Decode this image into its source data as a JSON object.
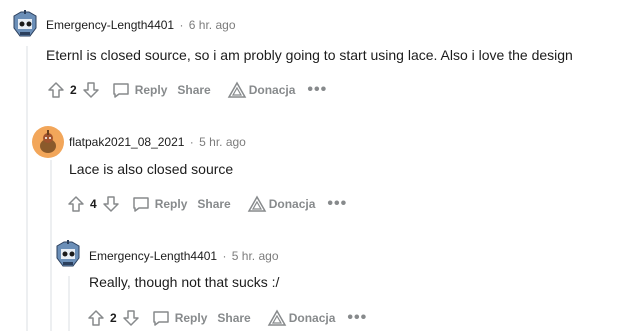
{
  "comments": [
    {
      "author": "Emergency-Length4401",
      "separator": "·",
      "time": "6 hr. ago",
      "text": "Eternl is closed source, so i am probly going to start using lace. Also i love the design",
      "score": "2",
      "reply_label": "Reply",
      "share_label": "Share",
      "award_label": "Donacja",
      "more_label": "•••"
    },
    {
      "author": "flatpak2021_08_2021",
      "separator": "·",
      "time": "5 hr. ago",
      "text": "Lace is also closed source",
      "score": "4",
      "reply_label": "Reply",
      "share_label": "Share",
      "award_label": "Donacja",
      "more_label": "•••"
    },
    {
      "author": "Emergency-Length4401",
      "separator": "·",
      "time": "5 hr. ago",
      "text": "Really, though not that sucks :/",
      "score": "2",
      "reply_label": "Reply",
      "share_label": "Share",
      "award_label": "Donacja",
      "more_label": "•••"
    }
  ],
  "colors": {
    "text": "#1c1c1c",
    "meta": "#7c7c7c",
    "action": "#878a8c",
    "thread_line": "#edeff1",
    "avatar_orange": "#f2a65a"
  }
}
